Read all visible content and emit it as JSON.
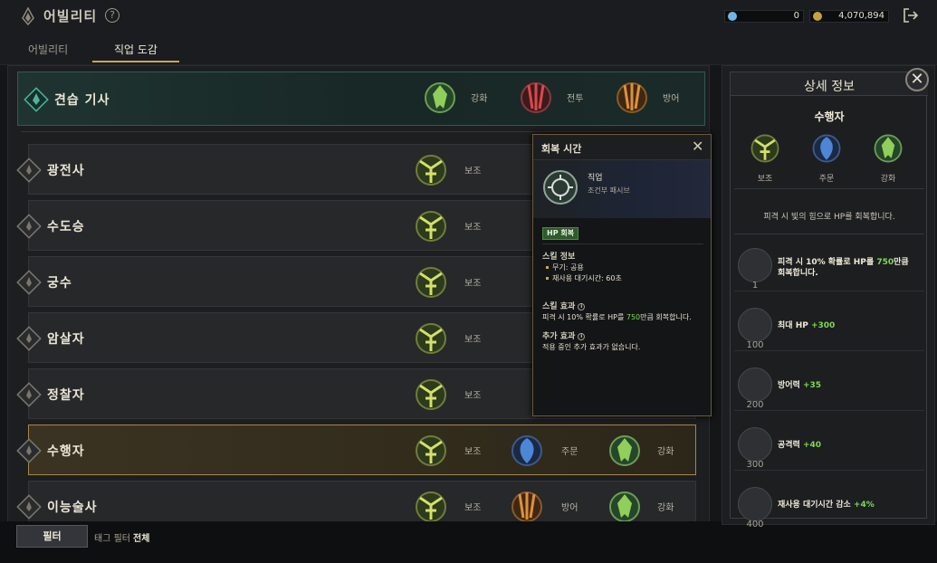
{
  "header": {
    "title": "어빌리티",
    "help_label": "?",
    "currency1": "0",
    "currency2": "4,070,894"
  },
  "tabs": [
    {
      "label": "어빌리티"
    },
    {
      "label": "직업 도감"
    }
  ],
  "rows": [
    {
      "name": "견습 기사",
      "skills": [
        "강화",
        "전투",
        "방어"
      ]
    },
    {
      "name": "광전사",
      "skills": [
        "보조"
      ]
    },
    {
      "name": "수도승",
      "skills": [
        "보조"
      ]
    },
    {
      "name": "궁수",
      "skills": [
        "보조"
      ]
    },
    {
      "name": "암살자",
      "skills": [
        "보조"
      ]
    },
    {
      "name": "정찰자",
      "skills": [
        "보조"
      ]
    },
    {
      "name": "수행자",
      "skills": [
        "보조",
        "주문",
        "강화"
      ]
    },
    {
      "name": "이능술사",
      "skills": [
        "보조",
        "방어",
        "강화"
      ]
    }
  ],
  "bottom": {
    "filter_label": "필터",
    "tag_filter_label": "태그 필터",
    "tag_filter_value": "전체"
  },
  "popup": {
    "title": "회복 시간",
    "close": "✕",
    "kind": "직업",
    "kind_sub": "조건부 패시브",
    "badge": "HP 회복",
    "info_title": "스킬 정보",
    "info_lines": [
      "무기: 공용",
      "재사용 대기시간: 60초"
    ],
    "effect_title": "스킬 효과",
    "effect_pre": "피격 시 10% 확률로 HP를 ",
    "effect_num": "750",
    "effect_post": "만큼 회복합니다.",
    "extra_title": "추가 효과",
    "extra_text": "적용 중인 추가 효과가 없습니다."
  },
  "detail": {
    "title": "상세 정보",
    "close": "✕",
    "name": "수행자",
    "skills": [
      "보조",
      "주문",
      "강화"
    ],
    "description": "피격 시 빛의 힘으로 HP를 회복합니다.",
    "perks": [
      {
        "num": "1",
        "pre": "피격 시 10% 확률로 HP를 ",
        "val": "750",
        "post": "만큼",
        "line2": "회복합니다."
      },
      {
        "num": "100",
        "pre": "최대 HP ",
        "val": "+300",
        "post": "",
        "line2": ""
      },
      {
        "num": "200",
        "pre": "방어력 ",
        "val": "+35",
        "post": "",
        "line2": ""
      },
      {
        "num": "300",
        "pre": "공격력 ",
        "val": "+40",
        "post": "",
        "line2": ""
      },
      {
        "num": "400",
        "pre": "재사용 대기시간 감소 ",
        "val": "+4%",
        "post": "",
        "line2": ""
      }
    ]
  }
}
